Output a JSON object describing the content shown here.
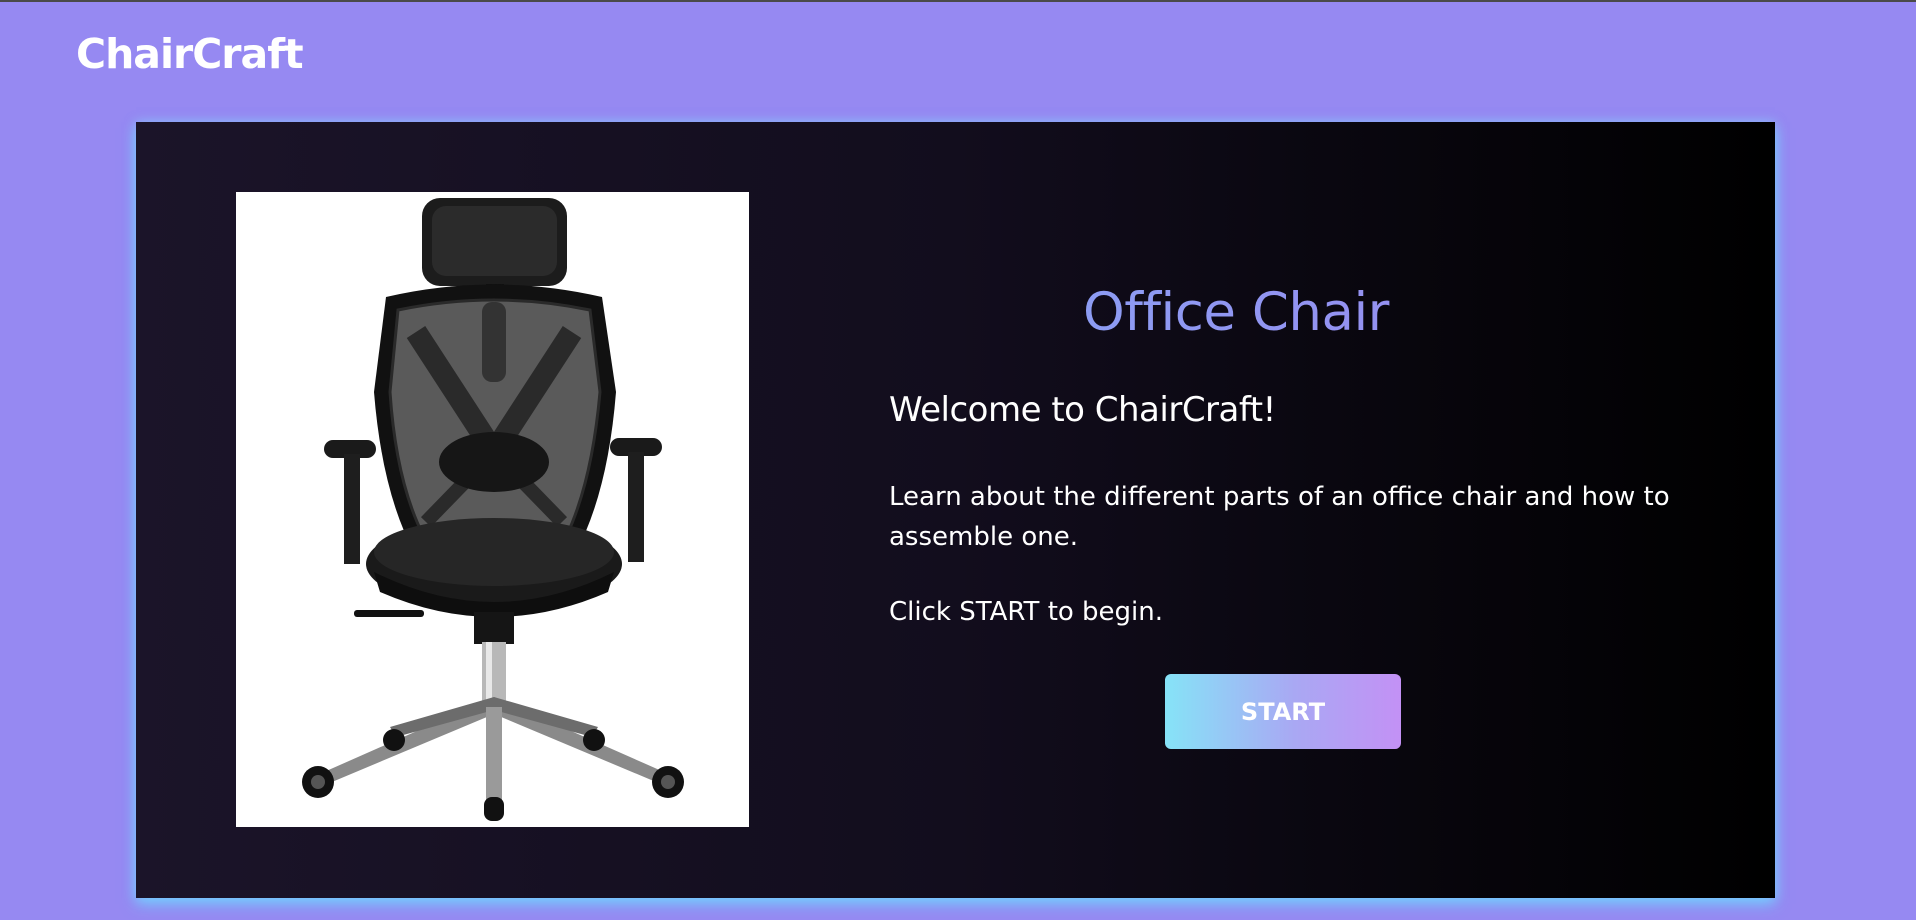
{
  "header": {
    "brand": "ChairCraft"
  },
  "main": {
    "title": "Office Chair",
    "welcome": "Welcome to ChairCraft!",
    "description": "Learn about the different parts of an office chair and how to assemble one.",
    "instruction": "Click START to begin.",
    "start_label": "START",
    "image_subject": "black ergonomic mesh office chair"
  },
  "colors": {
    "page_background": "#9689f2",
    "card_background": "#120d1d",
    "title_gradient": [
      "#86a5f5",
      "#9b88ef"
    ],
    "button_gradient": [
      "#86e3f7",
      "#c391f5"
    ]
  }
}
